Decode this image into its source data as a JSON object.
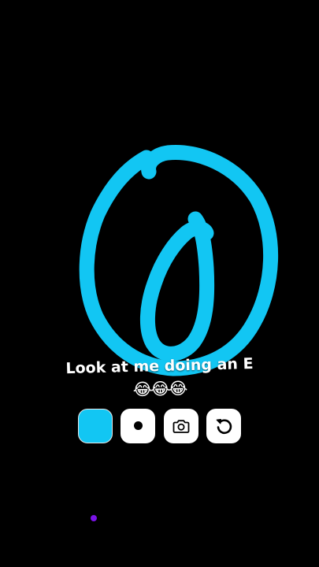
{
  "caption": {
    "line1": "Look at me doing an E",
    "line2": "😂😂😂"
  },
  "colors": {
    "background": "#000000",
    "stroke": "#12c6f3",
    "selected_color": "#12c6f3",
    "marker_dot": "#7a13e6"
  },
  "toolbar": {
    "buttons": [
      {
        "name": "color-picker",
        "icon": "color-swatch"
      },
      {
        "name": "brush-size",
        "icon": "dot-icon"
      },
      {
        "name": "camera",
        "icon": "camera-icon"
      },
      {
        "name": "undo",
        "icon": "undo-icon"
      }
    ]
  }
}
